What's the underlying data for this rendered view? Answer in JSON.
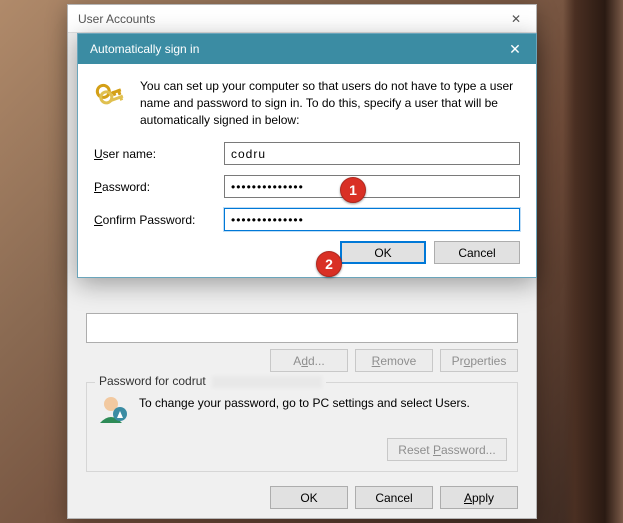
{
  "outer": {
    "title": "User Accounts",
    "buttons": {
      "add": "Add...",
      "remove": "Remove",
      "properties": "Properties",
      "ok": "OK",
      "cancel": "Cancel",
      "apply": "Apply"
    },
    "group": {
      "title_prefix": "Password for ",
      "user": "codrut",
      "help_text": "To change your password, go to PC settings and select Users.",
      "reset_button": "Reset Password..."
    }
  },
  "inner": {
    "title": "Automatically sign in",
    "intro": "You can set up your computer so that users do not have to type a user name and password to sign in. To do this, specify a user that will be automatically signed in below:",
    "labels": {
      "username": "User name:",
      "password": "Password:",
      "confirm": "Confirm Password:"
    },
    "values": {
      "username": "codru",
      "password_mask": "••••••••••••••",
      "confirm_mask": "••••••••••••••"
    },
    "buttons": {
      "ok": "OK",
      "cancel": "Cancel"
    }
  },
  "callouts": {
    "c1": "1",
    "c2": "2"
  }
}
